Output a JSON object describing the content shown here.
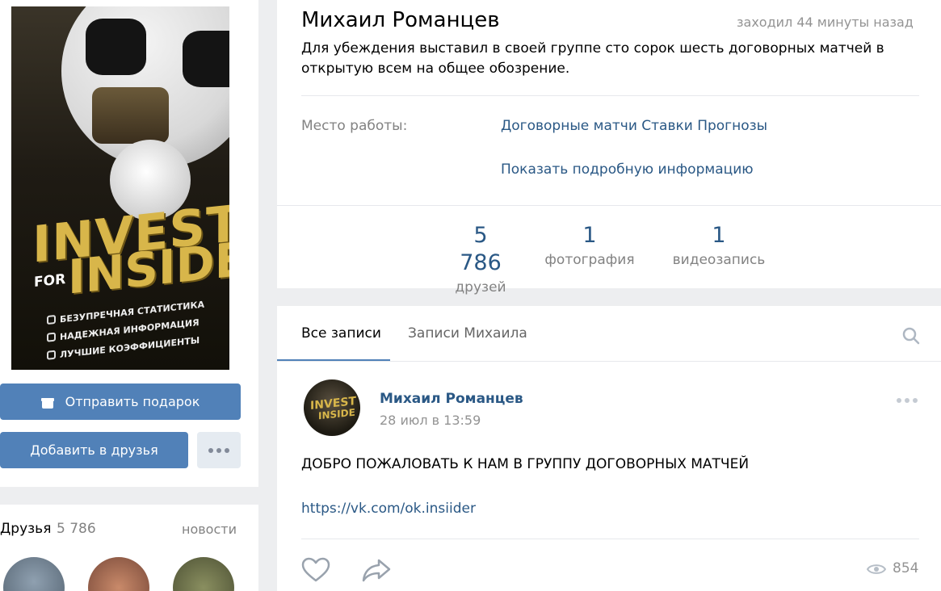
{
  "profile": {
    "name": "Михаил Романцев",
    "last_seen": "заходил 44 минуты назад",
    "status": "Для убеждения выставил в своей группе сто сорок шесть договорных матчей в открытую всем на общее обозрение.",
    "work_label": "Место работы:",
    "work_value": "Договорные матчи Ставки Прогнозы",
    "show_more": "Показать подробную информацию"
  },
  "avatar": {
    "logo_line1": "INVEST",
    "logo_for": "FOR",
    "logo_line2": "INSIDE",
    "features": [
      "БЕЗУПРЕЧНАЯ СТАТИСТИКА",
      "НАДЕЖНАЯ ИНФОРМАЦИЯ",
      "ЛУЧШИЕ КОЭФФИЦИЕНТЫ"
    ]
  },
  "actions": {
    "gift": "Отправить подарок",
    "add_friend": "Добавить в друзья"
  },
  "counters": [
    {
      "value": "5 786",
      "label": "друзей"
    },
    {
      "value": "1",
      "label": "фотография"
    },
    {
      "value": "1",
      "label": "видеозапись"
    }
  ],
  "friends_block": {
    "title": "Друзья",
    "count": "5 786",
    "news": "новости"
  },
  "wall": {
    "tabs": [
      "Все записи",
      "Записи Михаила"
    ],
    "post": {
      "author": "Михаил Романцев",
      "date": "28 июл в 13:59",
      "text": "ДОБРО ПОЖАЛОВАТЬ К НАМ В ГРУППУ ДОГОВОРНЫХ МАТЧЕЙ",
      "link": "https://vk.com/ok.insiider",
      "views": "854",
      "avatar_line1": "INVEST",
      "avatar_line2": "INSIDE"
    }
  },
  "icons": {
    "gift": "gift-icon",
    "more": "more-dots-icon",
    "search": "search-icon",
    "like": "heart-icon",
    "share": "share-arrow-icon",
    "views": "eye-icon"
  },
  "colors": {
    "accent": "#5181b8",
    "link": "#2a5885",
    "muted": "#828282",
    "background": "#edeef0"
  }
}
